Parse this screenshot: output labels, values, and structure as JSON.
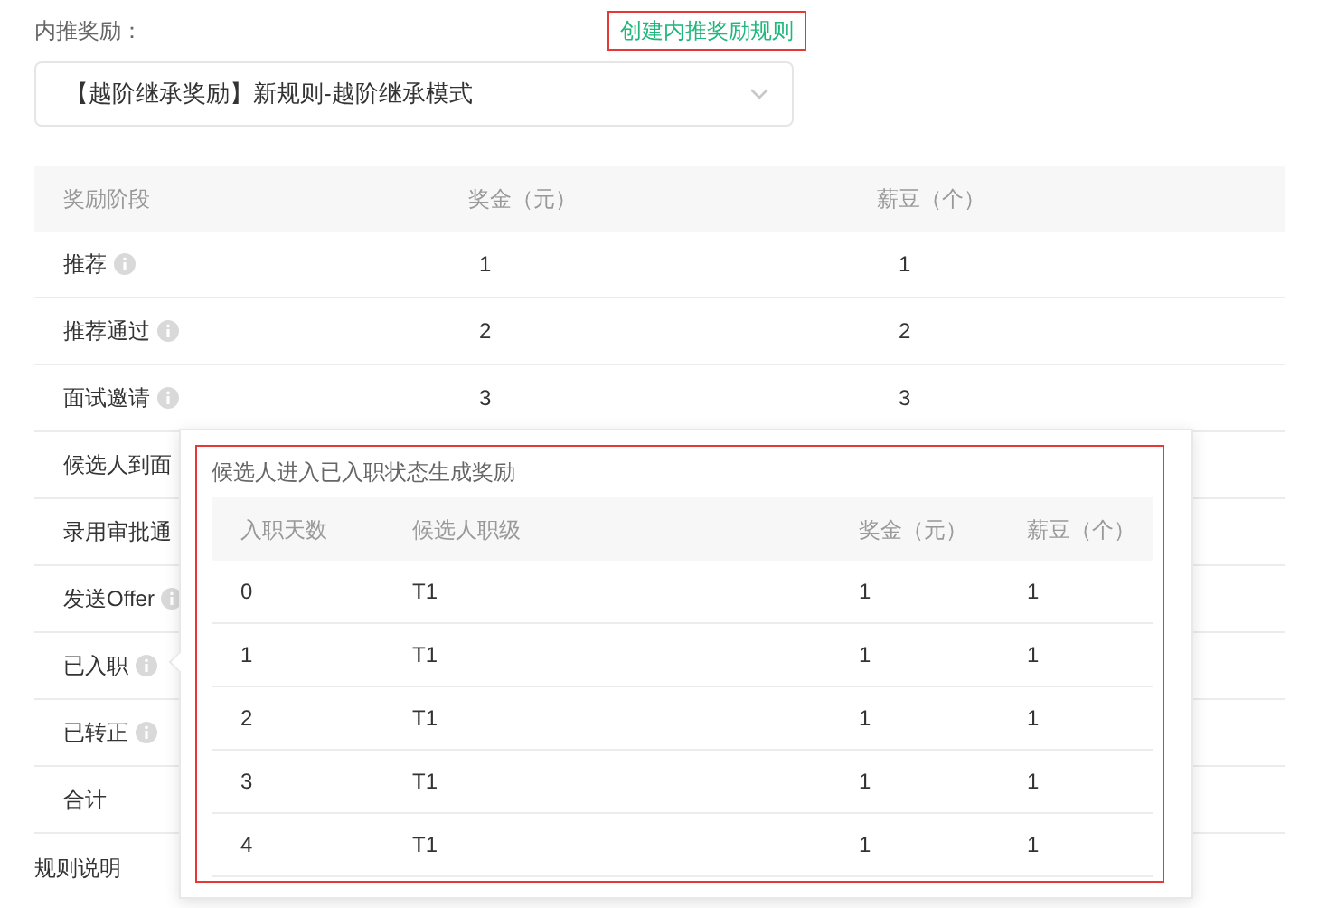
{
  "form_label": "内推奖励：",
  "create_link": "创建内推奖励规则",
  "rule_select": {
    "value": "【越阶继承奖励】新规则-越阶继承模式"
  },
  "table": {
    "columns": [
      "奖励阶段",
      "奖金（元）",
      "薪豆（个）"
    ],
    "rows": [
      {
        "stage": "推荐",
        "info_icon": true,
        "bonus": "1",
        "beans": "1"
      },
      {
        "stage": "推荐通过",
        "info_icon": true,
        "bonus": "2",
        "beans": "2"
      },
      {
        "stage": "面试邀请",
        "info_icon": true,
        "bonus": "3",
        "beans": "3"
      },
      {
        "stage": "候选人到面",
        "info_icon": false
      },
      {
        "stage": "录用审批通",
        "info_icon": false
      },
      {
        "stage": "发送Offer",
        "info_icon": true
      },
      {
        "stage": "已入职",
        "info_icon": true
      },
      {
        "stage": "已转正",
        "info_icon": true
      },
      {
        "stage": "合计",
        "info_icon": false
      }
    ]
  },
  "rules_heading": "规则说明",
  "popover": {
    "title": "候选人进入已入职状态生成奖励",
    "columns": [
      "入职天数",
      "候选人职级",
      "奖金（元）",
      "薪豆（个）"
    ],
    "rows": [
      [
        "0",
        "T1",
        "1",
        "1"
      ],
      [
        "1",
        "T1",
        "1",
        "1"
      ],
      [
        "2",
        "T1",
        "1",
        "1"
      ],
      [
        "3",
        "T1",
        "1",
        "1"
      ],
      [
        "4",
        "T1",
        "1",
        "1"
      ]
    ]
  }
}
